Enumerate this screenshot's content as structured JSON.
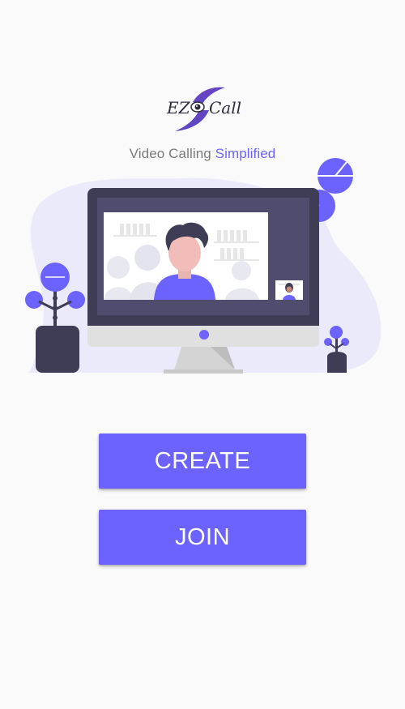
{
  "logo": {
    "text_left": "EZ",
    "text_right": "Call"
  },
  "tagline": {
    "prefix": "Video Calling",
    "highlight": "Simplified"
  },
  "actions": {
    "create_label": "CREATE",
    "join_label": "JOIN"
  },
  "colors": {
    "accent": "#6c63ff",
    "background": "#fafafa",
    "dark": "#3f3d56"
  }
}
